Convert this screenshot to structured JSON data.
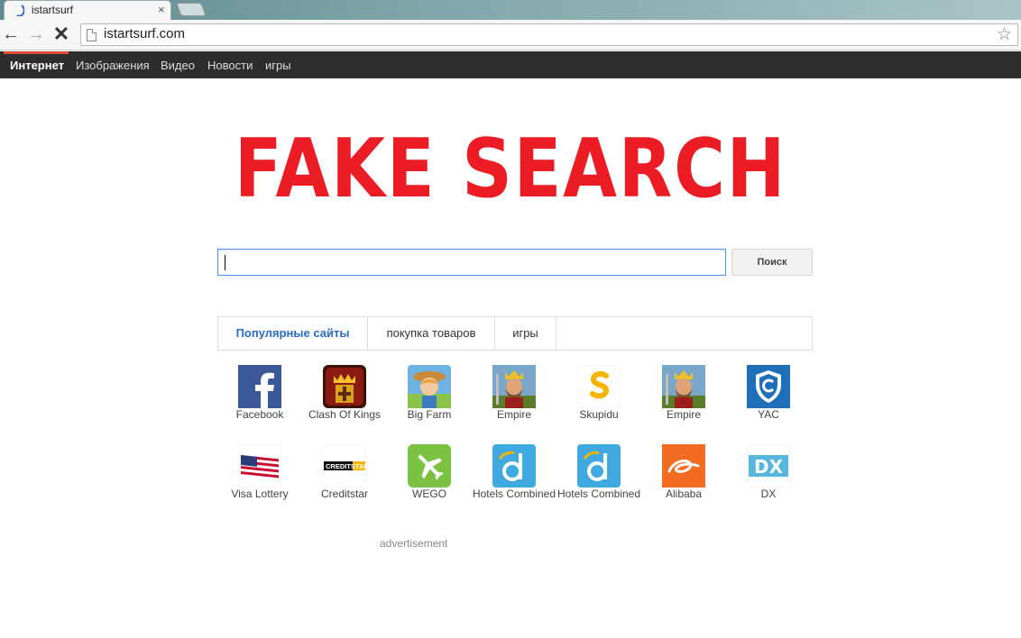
{
  "browser": {
    "tab_title": "istartsurf",
    "tab_close": "×",
    "url": "istartsurf.com",
    "back": "←",
    "forward": "→",
    "stop": "✕",
    "star": "☆"
  },
  "site_nav": {
    "items": [
      "Интернет",
      "Изображения",
      "Видео",
      "Новости",
      "игры"
    ],
    "active_index": 0
  },
  "logo": {
    "text": "FAKE SEARCH",
    "color": "#ec1c24"
  },
  "search": {
    "value": "",
    "button_label": "Поиск"
  },
  "tabs": [
    {
      "label": "Популярные сайты",
      "active": true
    },
    {
      "label": "покупка товаров",
      "active": false
    },
    {
      "label": "игры",
      "active": false
    }
  ],
  "tiles": [
    {
      "label": "Facebook",
      "icon": "facebook-icon"
    },
    {
      "label": "Clash Of Kings",
      "icon": "clash-of-kings-icon"
    },
    {
      "label": "Big Farm",
      "icon": "big-farm-icon"
    },
    {
      "label": "Empire",
      "icon": "empire-icon"
    },
    {
      "label": "Skupidu",
      "icon": "skupidu-icon"
    },
    {
      "label": "Empire",
      "icon": "empire-icon"
    },
    {
      "label": "YAC",
      "icon": "yac-shield-icon"
    },
    {
      "label": "Visa Lottery",
      "icon": "us-flag-icon"
    },
    {
      "label": "Creditstar",
      "icon": "creditstar-icon",
      "icon_text": "CREDITSTAR"
    },
    {
      "label": "WEGO",
      "icon": "wego-plane-icon"
    },
    {
      "label": "Hotels Combined",
      "icon": "hotels-combined-icon"
    },
    {
      "label": "Hotels Combined",
      "icon": "hotels-combined-icon"
    },
    {
      "label": "Alibaba",
      "icon": "alibaba-icon"
    },
    {
      "label": "DX",
      "icon": "dx-icon",
      "icon_text": "DX"
    }
  ],
  "advertisement": "advertisement"
}
